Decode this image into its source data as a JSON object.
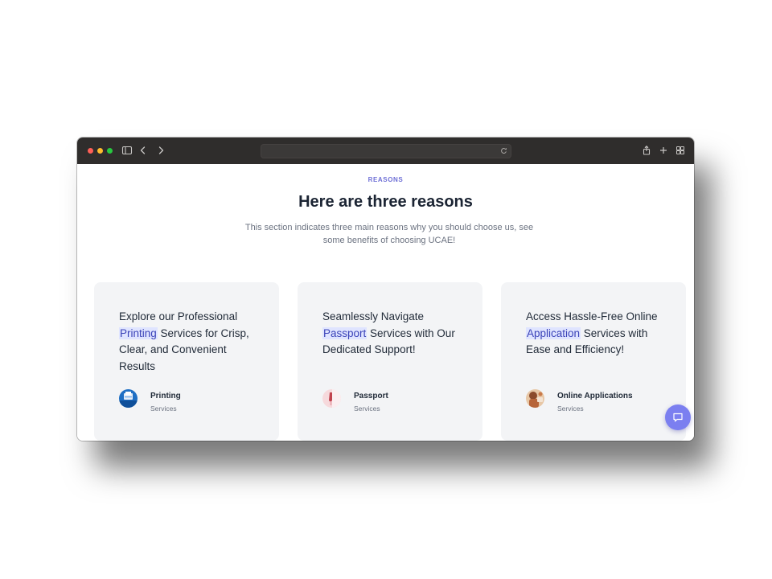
{
  "browser": {
    "url": ""
  },
  "section": {
    "eyebrow": "REASONS",
    "title": "Here are three reasons",
    "subtitle": "This section indicates three main reasons why you should choose us, see some benefits of choosing UCAE!"
  },
  "cards": [
    {
      "text_before": "Explore our Professional ",
      "highlight": "Printing",
      "text_after": " Services for Crisp, Clear, and Convenient Results",
      "title": "Printing",
      "subtitle": "Services",
      "icon": "printer-thumbnail"
    },
    {
      "text_before": "Seamlessly Navigate ",
      "highlight": "Passport",
      "text_after": " Services with Our Dedicated Support!",
      "title": "Passport",
      "subtitle": "Services",
      "icon": "passport-thumbnail"
    },
    {
      "text_before": "Access Hassle-Free Online ",
      "highlight": "Application",
      "text_after": " Services with Ease and Efficiency!",
      "title": "Online Applications",
      "subtitle": "Services",
      "icon": "online-application-thumbnail"
    }
  ],
  "colors": {
    "accent": "#6e6fd6",
    "highlight_bg": "#dfe4ff",
    "card_bg": "#f3f4f6",
    "chat_button": "#7b7ff0",
    "titlebar": "#2f2d2c"
  }
}
